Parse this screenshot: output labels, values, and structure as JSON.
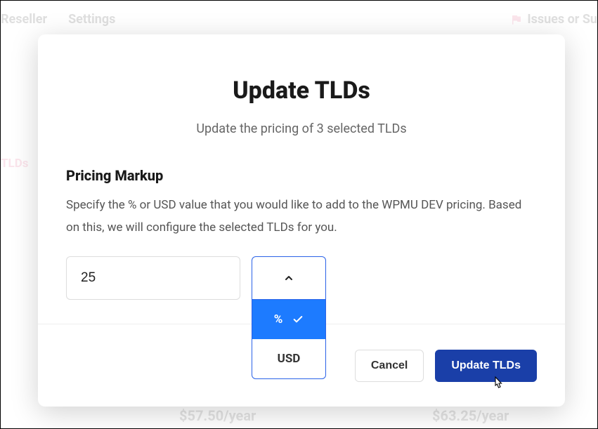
{
  "background": {
    "nav": {
      "reseller": "Reseller",
      "settings": "Settings"
    },
    "issues": "Issues or Su",
    "tlds_label": "TLDs",
    "price1": "$57.50/year",
    "price2": "$63.25/year"
  },
  "modal": {
    "title": "Update TLDs",
    "subtitle": "Update the pricing of 3 selected TLDs",
    "section_title": "Pricing Markup",
    "section_desc": "Specify the % or USD value that you would like to add to the WPMU DEV pricing. Based on this, we will configure the selected TLDs for you.",
    "markup_value": "25",
    "dropdown": {
      "options": {
        "percent": "%",
        "usd": "USD"
      },
      "selected": "%"
    },
    "footer": {
      "cancel": "Cancel",
      "confirm": "Update TLDs"
    }
  }
}
